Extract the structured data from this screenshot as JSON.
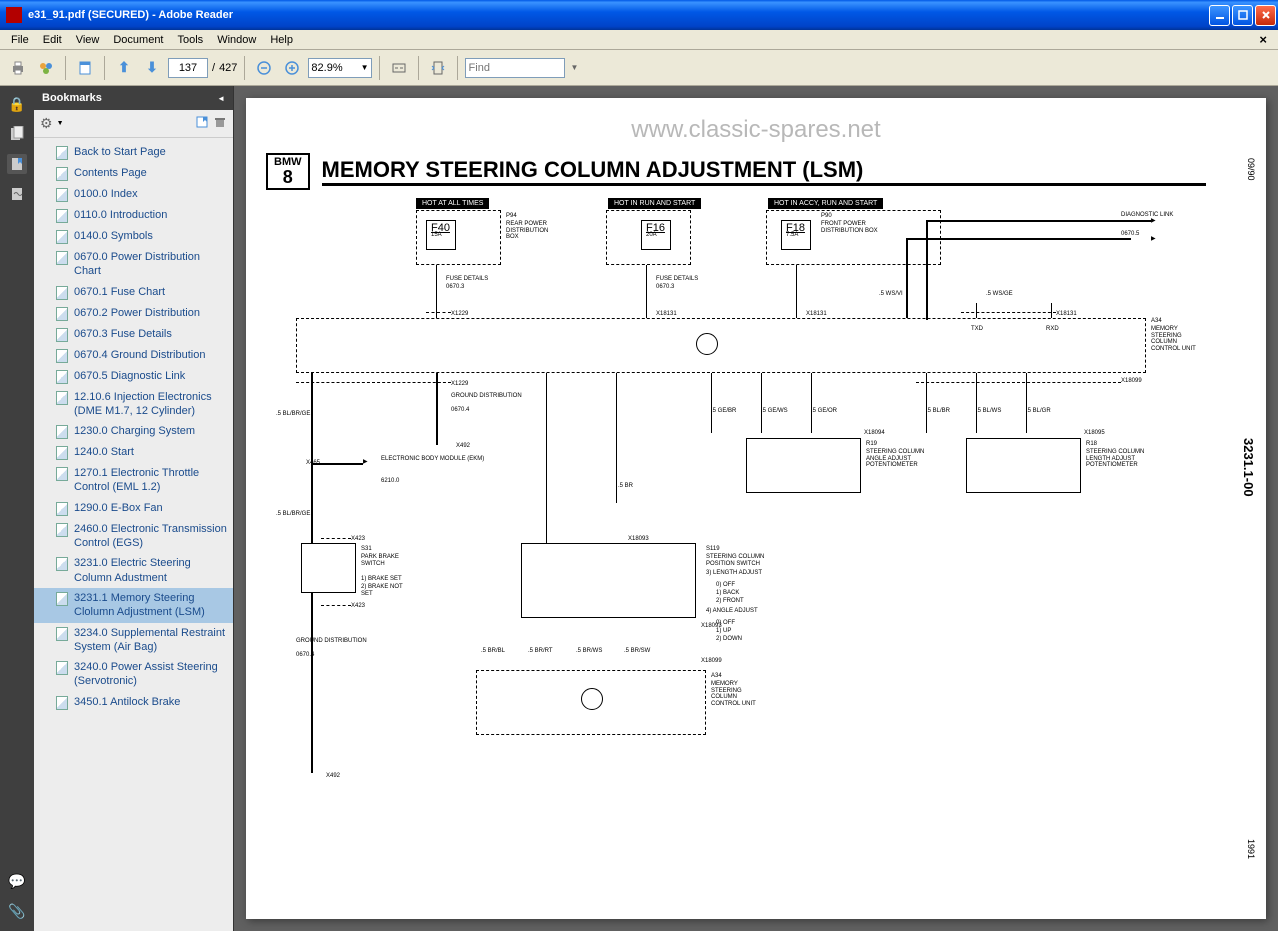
{
  "window": {
    "title": "e31_91.pdf (SECURED) - Adobe Reader"
  },
  "menu": {
    "file": "File",
    "edit": "Edit",
    "view": "View",
    "document": "Document",
    "tools": "Tools",
    "window": "Window",
    "help": "Help"
  },
  "toolbar": {
    "page_current": "137",
    "page_total": "427",
    "zoom": "82.9%",
    "find_placeholder": "Find"
  },
  "bookmarks": {
    "title": "Bookmarks",
    "items": [
      {
        "label": "Back to Start Page"
      },
      {
        "label": "Contents Page"
      },
      {
        "label": "0100.0 Index"
      },
      {
        "label": "0110.0 Introduction"
      },
      {
        "label": "0140.0 Symbols"
      },
      {
        "label": "0670.0 Power Distribution Chart"
      },
      {
        "label": "0670.1 Fuse Chart"
      },
      {
        "label": "0670.2 Power Distribution"
      },
      {
        "label": "0670.3 Fuse Details"
      },
      {
        "label": "0670.4 Ground Distribution"
      },
      {
        "label": "0670.5 Diagnostic Link"
      },
      {
        "label": "12.10.6 Injection Electronics (DME M1.7, 12 Cylinder)"
      },
      {
        "label": "1230.0 Charging System"
      },
      {
        "label": "1240.0 Start"
      },
      {
        "label": "1270.1 Electronic Throttle Control (EML 1.2)"
      },
      {
        "label": "1290.0 E-Box Fan"
      },
      {
        "label": "2460.0 Electronic Transmission Control (EGS)"
      },
      {
        "label": "3231.0 Electric Steering Column Adustment"
      },
      {
        "label": "3231.1 Memory Steering Clolumn Adjustment (LSM)",
        "selected": true
      },
      {
        "label": "3234.0 Supplemental Restraint System (Air Bag)"
      },
      {
        "label": "3240.0 Power Assist Steering (Servotronic)"
      },
      {
        "label": "3450.1 Antilock Brake"
      }
    ]
  },
  "page": {
    "watermark": "www.classic-spares.net",
    "bmw_line1": "BMW",
    "bmw_line2": "8",
    "title": "MEMORY STEERING COLUMN ADJUSTMENT (LSM)",
    "date": "09/90",
    "code": "3231.1-00",
    "year": "1991",
    "hot1": "HOT AT ALL TIMES",
    "hot2": "HOT IN RUN AND START",
    "hot3": "HOT IN ACCY, RUN AND START",
    "p94": "P94",
    "p94_desc": "REAR POWER DISTRIBUTION BOX",
    "f40": "F40",
    "f40_amp": "15A",
    "f16": "F16",
    "f16_amp": "20A",
    "f18": "F18",
    "f18_amp": "7.5A",
    "p90": "P90",
    "p90_desc": "FRONT POWER DISTRIBUTION BOX",
    "diag_link": "DIAGNOSTIC LINK",
    "diag_ref": "0670.5",
    "fuse_details": "FUSE DETAILS",
    "fuse_ref": "0670.3",
    "x1229": "X1229",
    "x18131": "X18131",
    "wire_wsvi": ".5 WS/VI",
    "wire_wsge": ".5 WS/GE",
    "txd": "TXD",
    "rxd": "RXD",
    "a34": "A34",
    "a34_desc": "MEMORY STEERING COLUMN CONTROL UNIT",
    "x18099": "X18099",
    "ground_dist": "GROUND DISTRIBUTION",
    "ground_ref": "0670.4",
    "x492": "X492",
    "wire_blbrge": ".5 BL/BR/GE",
    "wire_gebr": ".5 GE/BR",
    "wire_gews": ".5 GE/WS",
    "wire_geor": ".5 GE/OR",
    "wire_blbr": ".5 BL/BR",
    "wire_blws": ".5 BL/WS",
    "wire_blgr": ".5 BL/GR",
    "wire_br": ".5 BR",
    "x18094": "X18094",
    "x18095": "X18095",
    "r19": "R19",
    "r19_desc": "STEERING COLUMN ANGLE ADJUST POTENTIOMETER",
    "r18": "R18",
    "r18_desc": "STEERING COLUMN LENGTH ADJUST POTENTIOMETER",
    "x465": "X465",
    "ekm": "ELECTRONIC BODY MODULE (EKM)",
    "ekm_ref": "6210.0",
    "x423": "X423",
    "s31": "S31",
    "s31_desc": "PARK BRAKE SWITCH",
    "s31_1": "1) BRAKE SET",
    "s31_2": "2) BRAKE NOT SET",
    "x18093": "X18093",
    "s119": "S119",
    "s119_desc": "STEERING COLUMN POSITION SWITCH",
    "s119_3": "3) LENGTH ADJUST",
    "s119_0a": "0) OFF",
    "s119_1": "1) BACK",
    "s119_2": "2) FRONT",
    "s119_4": "4) ANGLE ADJUST",
    "s119_0b": "0) OFF",
    "s119_1b": "1) UP",
    "s119_2b": "2) DOWN",
    "wire_brbl": ".5 BR/BL",
    "wire_brrt": ".5 BR/RT",
    "wire_brws": ".5 BR/WS",
    "wire_brsw": ".5 BR/SW"
  }
}
